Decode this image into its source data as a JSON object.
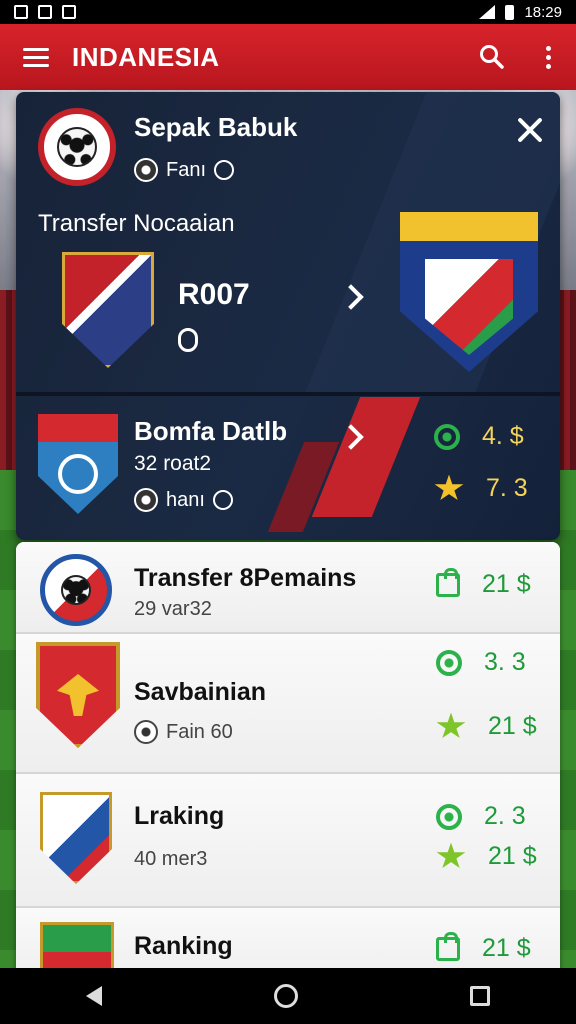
{
  "status_bar": {
    "time": "18:29"
  },
  "app_bar": {
    "title": "INDANESIA"
  },
  "featured": {
    "title": "Sepak Babuk",
    "subtitle": "Fanı",
    "section_title": "Transfer Nocaaian",
    "transfer_number": "R007"
  },
  "team_card": {
    "name": "Bomfa Datlb",
    "line1": "32 roat2",
    "line2": "hanı",
    "stat1_value": "4. $",
    "stat2_value": "7. 3"
  },
  "list": [
    {
      "title": "Transfer 8Pemains",
      "sub": "29 var32",
      "values": [
        "21 $"
      ]
    },
    {
      "title": "Savbainian",
      "sub": "Fain 60",
      "values": [
        "3. 3",
        "21 $"
      ]
    },
    {
      "title": "Lraking",
      "sub": "40 mer3",
      "values": [
        "2. 3",
        "21 $"
      ]
    },
    {
      "title": "Ranking",
      "sub": "",
      "values": [
        "21 $"
      ]
    }
  ],
  "colors": {
    "brand_red": "#d8232b",
    "accent_green": "#1f9a3a",
    "accent_gold": "#f3d35a"
  }
}
